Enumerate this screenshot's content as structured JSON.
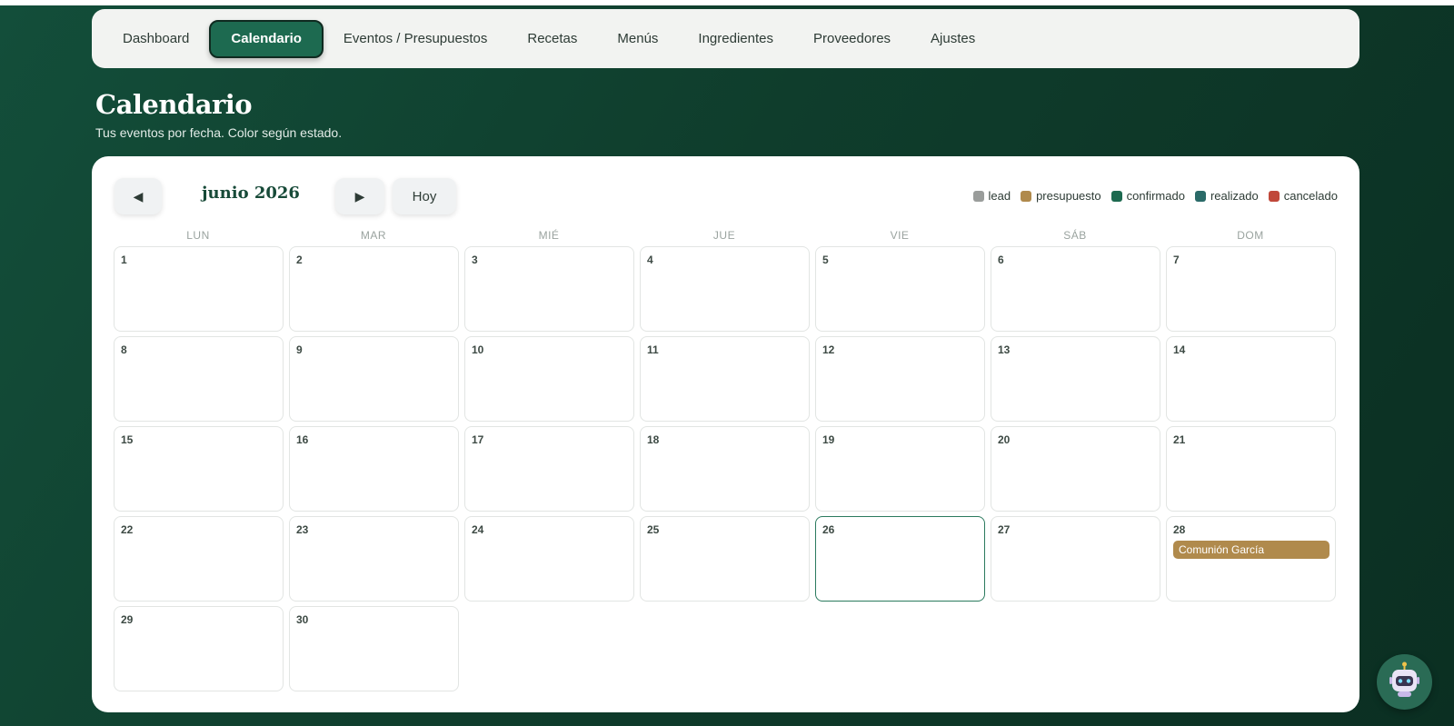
{
  "nav": {
    "items": [
      {
        "label": "Dashboard",
        "active": false
      },
      {
        "label": "Calendario",
        "active": true
      },
      {
        "label": "Eventos / Presupuestos",
        "active": false
      },
      {
        "label": "Recetas",
        "active": false
      },
      {
        "label": "Menús",
        "active": false
      },
      {
        "label": "Ingredientes",
        "active": false
      },
      {
        "label": "Proveedores",
        "active": false
      },
      {
        "label": "Ajustes",
        "active": false
      }
    ]
  },
  "page": {
    "title": "Calendario",
    "subtitle": "Tus eventos por fecha. Color según estado."
  },
  "calendar": {
    "prev_label": "◀",
    "next_label": "▶",
    "today_label": "Hoy",
    "month_label": "junio 2026",
    "today_day": "26",
    "weekdays": [
      "LUN",
      "MAR",
      "MIÉ",
      "JUE",
      "VIE",
      "SÁB",
      "DOM"
    ],
    "days": [
      "1",
      "2",
      "3",
      "4",
      "5",
      "6",
      "7",
      "8",
      "9",
      "10",
      "11",
      "12",
      "13",
      "14",
      "15",
      "16",
      "17",
      "18",
      "19",
      "20",
      "21",
      "22",
      "23",
      "24",
      "25",
      "26",
      "27",
      "28",
      "29",
      "30"
    ],
    "events": [
      {
        "day": "28",
        "title": "Comunión García",
        "status": "presupuesto"
      }
    ]
  },
  "legend": [
    {
      "label": "lead",
      "color": "#9a9d9b"
    },
    {
      "label": "presupuesto",
      "color": "#b08a4c"
    },
    {
      "label": "confirmado",
      "color": "#1d6a50"
    },
    {
      "label": "realizado",
      "color": "#2a6a68"
    },
    {
      "label": "cancelado",
      "color": "#c0483a"
    }
  ],
  "assistant": {
    "icon": "robot-icon"
  }
}
